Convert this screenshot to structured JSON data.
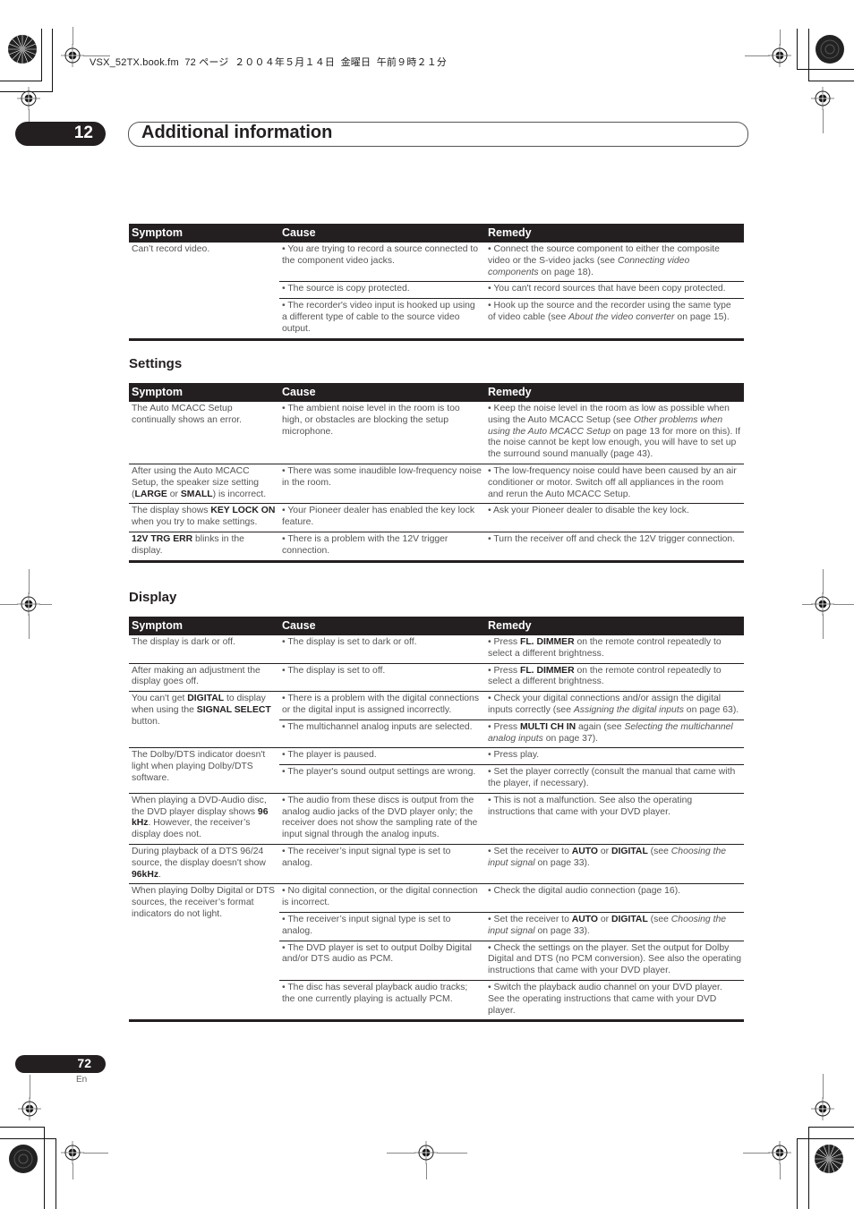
{
  "file_header": "VSX_52TX.book.fm  72 ページ  ２００４年５月１４日  金曜日  午前９時２１分",
  "chapter": {
    "number": "12",
    "title": "Additional information"
  },
  "columns": {
    "symptom": "Symptom",
    "cause": "Cause",
    "remedy": "Remedy"
  },
  "sections": [
    {
      "title": "",
      "rows": [
        {
          "symptom": "Can’t record video.",
          "items": [
            {
              "cause": "• You are trying to record a source connected to the component video jacks.",
              "remedy": "• Connect the source component to either the composite video or the S-video jacks (see <i>Connecting video components</i> on page 18)."
            },
            {
              "cause": "• The source is copy protected.",
              "remedy": "• You can't record sources that have been copy protected."
            },
            {
              "cause": "• The recorder's video input is hooked up using a different type of cable to the source video output.",
              "remedy": "• Hook up the source and the recorder using the same type of video cable (see <i>About the video converter</i> on page 15)."
            }
          ]
        }
      ]
    },
    {
      "title": "Settings",
      "rows": [
        {
          "symptom": "The Auto MCACC Setup continually shows an error.",
          "items": [
            {
              "cause": "• The ambient noise level in the room is too high, or obstacles are blocking the setup microphone.",
              "remedy": "• Keep the noise level in the room as low as possible when using the Auto MCACC Setup (see <i>Other problems when using the Auto MCACC Setup</i> on page 13 for more on this). If the noise cannot be kept low enough, you will have to set up the surround sound manually (page 43)."
            }
          ]
        },
        {
          "symptom": "After using the Auto MCACC Setup, the speaker size setting (<b>LARGE</b> or <b>SMALL</b>) is incorrect.",
          "items": [
            {
              "cause": "• There was some inaudible low-frequency noise in the room.",
              "remedy": "• The low-frequency noise could have been caused by an air conditioner or motor. Switch off all appliances in the room and rerun the Auto MCACC Setup."
            }
          ]
        },
        {
          "symptom": "The display shows <b>KEY LOCK ON</b> when you try to make settings.",
          "items": [
            {
              "cause": "• Your Pioneer dealer has enabled the key lock feature.",
              "remedy": "• Ask your Pioneer dealer to disable the key lock."
            }
          ]
        },
        {
          "symptom": "<b>12V TRG ERR</b> blinks in the display.",
          "items": [
            {
              "cause": "• There is a problem with the 12V trigger connection.",
              "remedy": "• Turn the receiver off and check the 12V trigger connection."
            }
          ]
        }
      ]
    },
    {
      "title": "Display",
      "rows": [
        {
          "symptom": "The display is dark or off.",
          "items": [
            {
              "cause": "• The display is set to dark or off.",
              "remedy": "• Press <b>FL. DIMMER</b> on the remote control repeatedly to select a different brightness."
            }
          ]
        },
        {
          "symptom": "After making an adjustment the display goes off.",
          "items": [
            {
              "cause": "• The display is set to off.",
              "remedy": "• Press <b>FL. DIMMER</b> on the remote control repeatedly to select a different brightness."
            }
          ]
        },
        {
          "symptom": "You can't get <b>DIGITAL</b> to display when using the <b>SIGNAL SELECT</b> button.",
          "items": [
            {
              "cause": "• There is a problem with the digital connections or the digital input is assigned incorrectly.",
              "remedy": "• Check your digital connections and/or assign the digital inputs correctly (see <i>Assigning the digital inputs</i> on page 63)."
            },
            {
              "cause": "• The multichannel analog inputs are selected.",
              "remedy": "• Press <b>MULTI CH IN</b> again (see <i>Selecting the multichannel analog inputs</i> on page 37)."
            }
          ]
        },
        {
          "symptom": "The Dolby/DTS indicator doesn't light when playing Dolby/DTS software.",
          "items": [
            {
              "cause": "• The player is paused.",
              "remedy": "• Press play."
            },
            {
              "cause": "• The player's sound output settings are wrong.",
              "remedy": "• Set the player correctly (consult the manual that came with the player, if necessary)."
            }
          ]
        },
        {
          "symptom": "When playing a DVD-Audio disc, the DVD player display shows <b>96 kHz</b>. However, the receiver’s display does not.",
          "items": [
            {
              "cause": "• The audio from these discs is output from the analog audio jacks of the DVD player only; the receiver does not show the sampling rate of the input signal through the analog inputs.",
              "remedy": "• This is not a malfunction. See also the operating instructions that came with your DVD player."
            }
          ]
        },
        {
          "symptom": "During playback of a DTS 96/24 source, the display doesn't show <b>96kHz</b>.",
          "items": [
            {
              "cause": "• The receiver’s input signal type is set to analog.",
              "remedy": "• Set the receiver to <b>AUTO</b> or <b>DIGITAL</b> (see <i>Choosing the input signal</i> on page 33)."
            }
          ]
        },
        {
          "symptom": "When playing Dolby Digital or DTS sources, the receiver’s format indicators do not light.",
          "items": [
            {
              "cause": "• No digital connection, or the digital connection is incorrect.",
              "remedy": "• Check the digital audio connection (page 16)."
            },
            {
              "cause": "• The receiver’s input signal type is set to analog.",
              "remedy": "• Set the receiver to <b>AUTO</b> or <b>DIGITAL</b> (see <i>Choosing the input signal</i> on page 33)."
            },
            {
              "cause": "• The DVD player is set to output Dolby Digital and/or DTS audio as PCM.",
              "remedy": "• Check the settings on the player. Set the output for Dolby Digital and DTS (no PCM conversion). See also the operating instructions that came with your DVD player."
            },
            {
              "cause": "• The disc has several playback audio tracks; the one currently playing is actually PCM.",
              "remedy": "• Switch the playback audio channel on your DVD player. See the operating instructions that came with your DVD player."
            }
          ]
        }
      ]
    }
  ],
  "footer": {
    "page_number": "72",
    "language": "En"
  },
  "icons": {
    "registration_mark": "registration-crosshair-icon",
    "color_rosette": "print-rosette-icon"
  }
}
